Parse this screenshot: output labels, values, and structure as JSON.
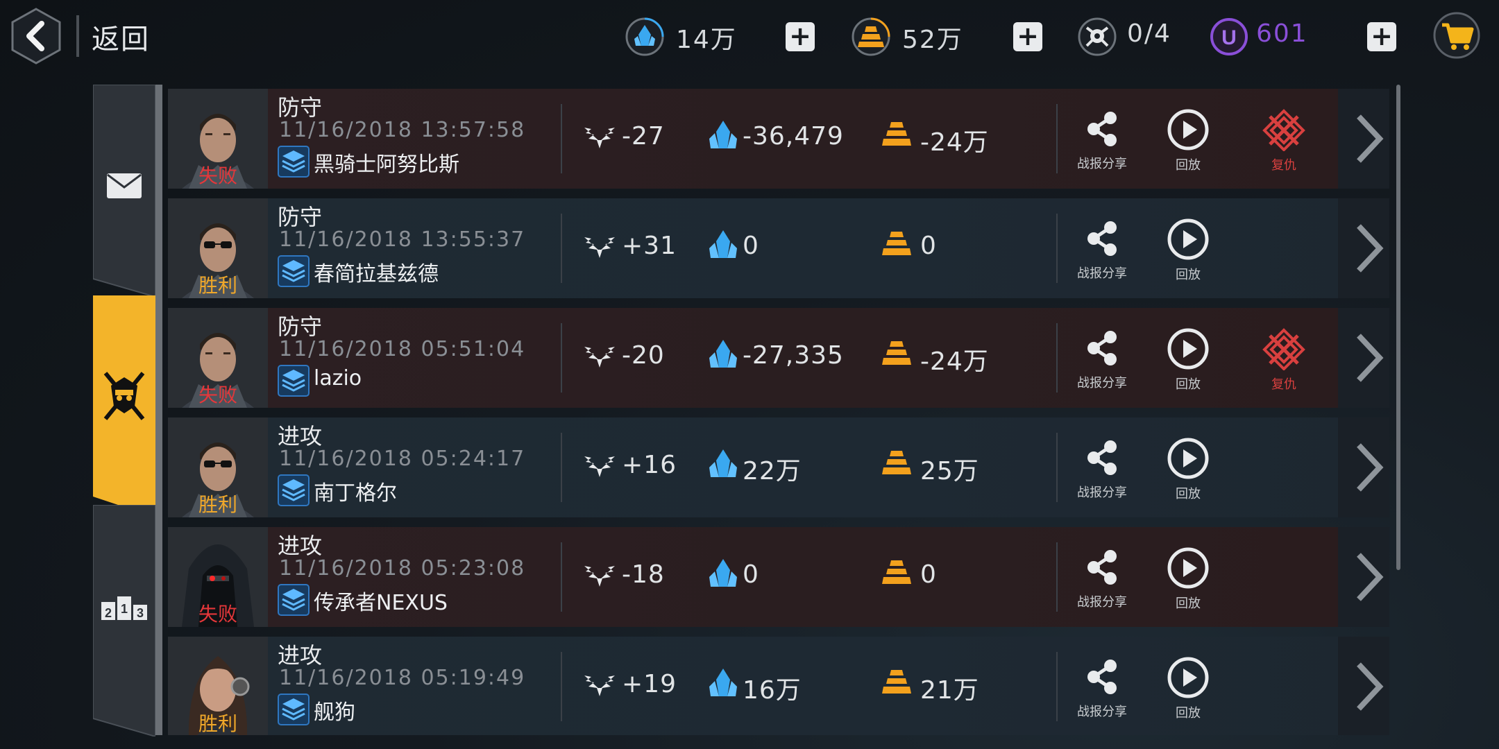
{
  "topbar": {
    "back_label": "返回",
    "resources": [
      {
        "name": "crystal",
        "value": "14万"
      },
      {
        "name": "gold",
        "value": "52万"
      },
      {
        "name": "drone",
        "value": "0/4"
      },
      {
        "name": "unit-currency",
        "value": "601"
      }
    ]
  },
  "side_tabs": [
    "mail",
    "battle-log",
    "ranking"
  ],
  "active_tab": "battle-log",
  "colors": {
    "accent": "#f3b42a",
    "loss": "#e5373a",
    "win": "#f0a82a",
    "crystal": "#3aa8f0",
    "gold": "#f3a11d",
    "purple": "#8a4fd8"
  },
  "actions": {
    "share": "战报分享",
    "replay": "回放",
    "revenge": "复仇"
  },
  "rows": [
    {
      "result": "失败",
      "outcome": "loss",
      "mode": "防守",
      "time": "11/16/2018 13:57:58",
      "player": "黑骑士阿努比斯",
      "trophy": "-27",
      "crystal": "-36,479",
      "gold": "-24万",
      "avatar": "soldier",
      "revenge": true
    },
    {
      "result": "胜利",
      "outcome": "win",
      "mode": "防守",
      "time": "11/16/2018 13:55:37",
      "player": "春简拉基兹德",
      "trophy": "+31",
      "crystal": "0",
      "gold": "0",
      "avatar": "shades",
      "revenge": false
    },
    {
      "result": "失败",
      "outcome": "loss",
      "mode": "防守",
      "time": "11/16/2018 05:51:04",
      "player": "lazio",
      "trophy": "-20",
      "crystal": "-27,335",
      "gold": "-24万",
      "avatar": "soldier",
      "revenge": true
    },
    {
      "result": "胜利",
      "outcome": "win",
      "mode": "进攻",
      "time": "11/16/2018 05:24:17",
      "player": "南丁格尔",
      "trophy": "+16",
      "crystal": "22万",
      "gold": "25万",
      "avatar": "shades",
      "revenge": false
    },
    {
      "result": "失败",
      "outcome": "loss",
      "mode": "进攻",
      "time": "11/16/2018 05:23:08",
      "player": "传承者NEXUS",
      "trophy": "-18",
      "crystal": "0",
      "gold": "0",
      "avatar": "hood",
      "revenge": false
    },
    {
      "result": "胜利",
      "outcome": "win",
      "mode": "进攻",
      "time": "11/16/2018 05:19:49",
      "player": "舰狗",
      "trophy": "+19",
      "crystal": "16万",
      "gold": "21万",
      "avatar": "woman",
      "revenge": false
    }
  ]
}
